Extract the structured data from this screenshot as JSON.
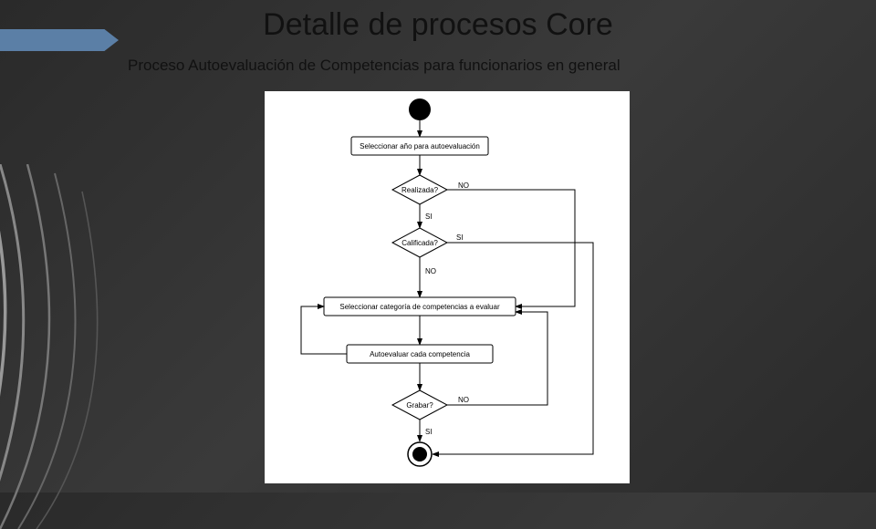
{
  "slide": {
    "title": "Detalle de procesos Core",
    "subtitle": "Proceso Autoevaluación de Competencias para funcionarios en general"
  },
  "flowchart": {
    "start": "",
    "step1": "Seleccionar año para autoevaluación",
    "decision1": {
      "label": "Realizada?",
      "yes": "SI",
      "no": "NO"
    },
    "decision2": {
      "label": "Calificada?",
      "yes": "SI",
      "no": "NO"
    },
    "step2": "Seleccionar categoría de competencias a evaluar",
    "step3": "Autoevaluar cada competencia",
    "decision3": {
      "label": "Grabar?",
      "yes": "SI",
      "no": "NO"
    },
    "end": ""
  },
  "chart_data": {
    "type": "flowchart",
    "nodes": [
      {
        "id": "start",
        "kind": "start",
        "label": ""
      },
      {
        "id": "n1",
        "kind": "process",
        "label": "Seleccionar año para autoevaluación"
      },
      {
        "id": "d1",
        "kind": "decision",
        "label": "Realizada?"
      },
      {
        "id": "d2",
        "kind": "decision",
        "label": "Calificada?"
      },
      {
        "id": "n2",
        "kind": "process",
        "label": "Seleccionar categoría de competencias a evaluar"
      },
      {
        "id": "n3",
        "kind": "process",
        "label": "Autoevaluar cada competencia"
      },
      {
        "id": "d3",
        "kind": "decision",
        "label": "Grabar?"
      },
      {
        "id": "end",
        "kind": "end",
        "label": ""
      }
    ],
    "edges": [
      {
        "from": "start",
        "to": "n1",
        "label": ""
      },
      {
        "from": "n1",
        "to": "d1",
        "label": ""
      },
      {
        "from": "d1",
        "to": "d2",
        "label": "SI"
      },
      {
        "from": "d1",
        "to": "n2",
        "label": "NO"
      },
      {
        "from": "d2",
        "to": "n2",
        "label": "NO"
      },
      {
        "from": "d2",
        "to": "end",
        "label": "SI"
      },
      {
        "from": "n2",
        "to": "n3",
        "label": ""
      },
      {
        "from": "n3",
        "to": "d3",
        "label": ""
      },
      {
        "from": "d3",
        "to": "end",
        "label": "SI"
      },
      {
        "from": "d3",
        "to": "n2",
        "label": "NO"
      },
      {
        "from": "n3",
        "to": "n2",
        "label": ""
      }
    ]
  }
}
